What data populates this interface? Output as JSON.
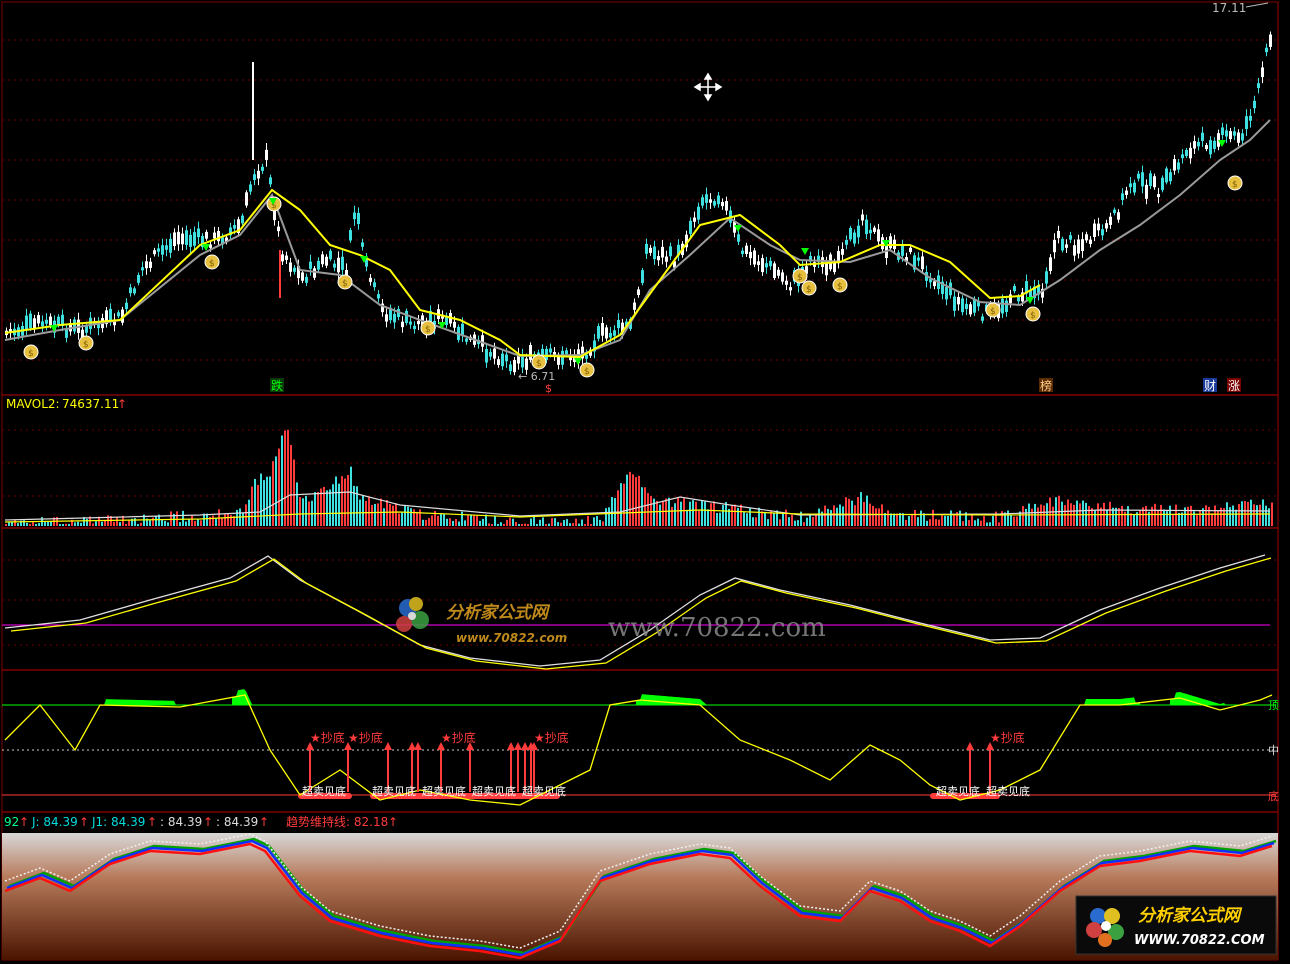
{
  "main": {
    "top_right_price": "17.11",
    "low_price_label": "← 6.71",
    "markers": [
      "跌",
      "榜",
      "财",
      "涨"
    ],
    "signal_glyph": "$"
  },
  "volume": {
    "label": "MAVOL2:",
    "value": "74637.11",
    "arrow": "↑"
  },
  "watermark": {
    "logo_text": "分析家公式网",
    "site_text": "www.70822.com",
    "logo_url_text": "www.70822.com"
  },
  "signal_panel": {
    "buy_label": "★抄底",
    "oversold_label": "超卖见底",
    "right_labels": [
      "顶",
      "中",
      "底"
    ]
  },
  "kdj": {
    "prefix": "92",
    "j_label": "J: 84.39",
    "j1_label": "J1: 84.39",
    "v3_label": ": 84.39",
    "v4_label": ": 84.39",
    "trend_label": "趋势维持线: 82.18",
    "arrow": "↑"
  },
  "brand": {
    "name": "分析家公式网",
    "url": "WWW.70822.COM"
  },
  "colors": {
    "up": "#ff3b3b",
    "down": "#3fe0e0",
    "grid": "#a00000",
    "ma_fast": "#ffff00",
    "ma_slow": "#9a9a9a",
    "green": "#00ff00",
    "magenta": "#ff00ff"
  }
}
